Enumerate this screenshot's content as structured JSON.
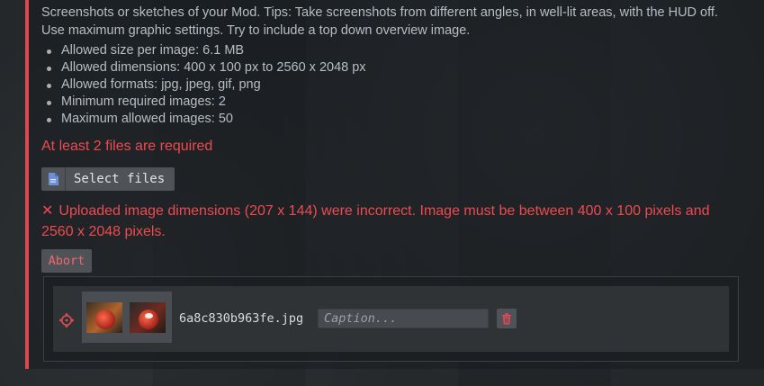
{
  "description": "Screenshots or sketches of your Mod. Tips: Take screenshots from different angles, in well-lit areas, with the HUD off. Use maximum graphic settings. Try to include a top down overview image.",
  "rules": [
    "Allowed size per image: 6.1 MB",
    "Allowed dimensions: 400 x 100 px to 2560 x 2048 px",
    "Allowed formats: jpg, jpeg, gif, png",
    "Minimum required images: 2",
    "Maximum allowed images: 50"
  ],
  "required_message": "At least 2 files are required",
  "select_button": {
    "icon": "file-icon",
    "label": "Select files"
  },
  "error": {
    "icon": "close-icon",
    "x_glyph": "✕",
    "text": "Uploaded image dimensions (207 x 144) were incorrect. Image must be between 400 x 100 pixels and 2560 x 2048 pixels."
  },
  "abort_label": "Abort",
  "upload_item": {
    "drag_icon": "move-icon",
    "filename": "6a8c830b963fe.jpg",
    "caption_value": "",
    "caption_placeholder": "Caption...",
    "delete_icon": "trash-icon"
  },
  "colors": {
    "accent": "#d84a4f",
    "error_text": "#ee4a4f",
    "button_bg": "#4f5357"
  }
}
